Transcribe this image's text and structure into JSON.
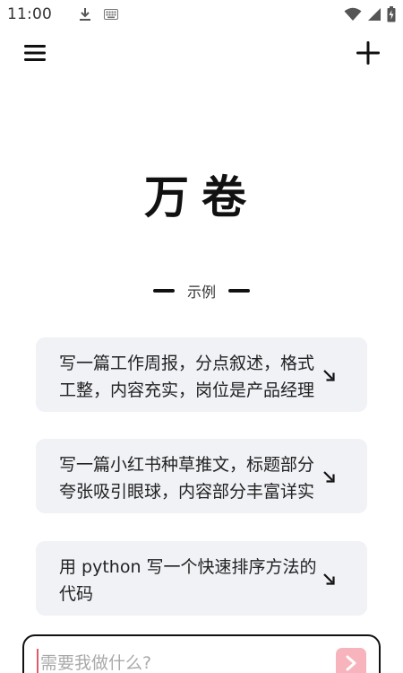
{
  "status_bar": {
    "time": "11:00",
    "left_icons": [
      "download-icon",
      "keyboard-icon"
    ],
    "right_icons": [
      "wifi-icon",
      "cellular-signal-icon",
      "battery-icon"
    ]
  },
  "top_bar": {
    "menu_icon": "hamburger-menu-icon",
    "add_icon": "plus-icon"
  },
  "app": {
    "title": "万卷"
  },
  "examples": {
    "label": "示例",
    "items": [
      {
        "text": "写一篇工作周报，分点叙述，格式工整，内容充实，岗位是产品经理",
        "arrow_icon": "arrow-down-right-icon"
      },
      {
        "text": "写一篇小红书种草推文，标题部分夸张吸引眼球，内容部分丰富详实",
        "arrow_icon": "arrow-down-right-icon"
      },
      {
        "text": "用 python 写一个快速排序方法的代码",
        "arrow_icon": "arrow-down-right-icon"
      }
    ]
  },
  "input": {
    "placeholder": "需要我做什么?",
    "value": "",
    "send_icon": "chevron-right-icon"
  },
  "colors": {
    "card_background": "#f1f2f6",
    "send_button": "#f7b4bd",
    "cursor": "#e05a6b",
    "text": "#222222"
  }
}
